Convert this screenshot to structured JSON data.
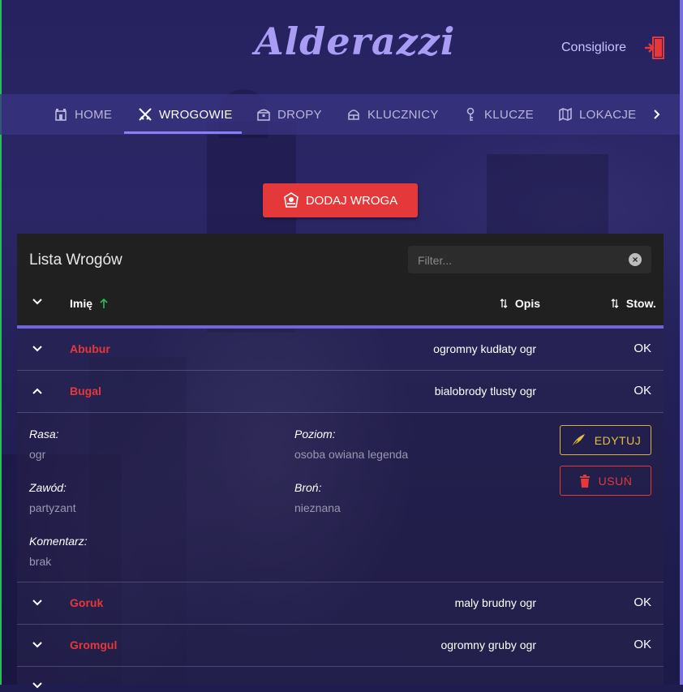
{
  "app": {
    "title": "Alderazzi"
  },
  "user": {
    "name": "Consigliore",
    "logout_icon": "logout-door-icon"
  },
  "nav": {
    "items": [
      {
        "label": "HOME",
        "icon": "home-icon"
      },
      {
        "label": "WROGOWIE",
        "icon": "crossed-swords-icon"
      },
      {
        "label": "DROPY",
        "icon": "chest-icon"
      },
      {
        "label": "KLUCZNICY",
        "icon": "helmet-icon"
      },
      {
        "label": "KLUCZE",
        "icon": "key-icon"
      },
      {
        "label": "LOKACJE",
        "icon": "map-icon"
      }
    ],
    "active": "WROGOWIE",
    "next_icon": "chevron-right-icon"
  },
  "add_button": {
    "label": "DODAJ WROGA",
    "icon": "enemy-crest-icon"
  },
  "table": {
    "title": "Lista Wrogów",
    "filter_placeholder": "Filter...",
    "columns": {
      "name": "Imię",
      "description": "Opis",
      "status": "Stow."
    },
    "sort": {
      "column": "Imię",
      "direction": "ascending"
    },
    "rows": [
      {
        "name": "Abubur",
        "description": "ogromny kudłaty ogr",
        "status": "OK",
        "expanded": false
      },
      {
        "name": "Bugal",
        "description": "bialobrody tlusty ogr",
        "status": "OK",
        "expanded": true
      },
      {
        "name": "Goruk",
        "description": "maly brudny ogr",
        "status": "OK",
        "expanded": false
      },
      {
        "name": "Gromgul",
        "description": "ogromny gruby ogr",
        "status": "OK",
        "expanded": false
      }
    ],
    "expanded_detail": {
      "rasa_label": "Rasa:",
      "rasa": "ogr",
      "poziom_label": "Poziom:",
      "poziom": "osoba owiana legenda",
      "zawod_label": "Zawód:",
      "zawod": "partyzant",
      "bron_label": "Broń:",
      "bron": "nieznana",
      "komentarz_label": "Komentarz:",
      "komentarz": "brak",
      "edit_label": "EDYTUJ",
      "delete_label": "USUŃ"
    }
  },
  "colors": {
    "accent": "#8a7ff5",
    "danger": "#e5383b",
    "edit": "#e3bf42",
    "nav_bg": "#3a3482",
    "panel_bg": "#202020"
  }
}
